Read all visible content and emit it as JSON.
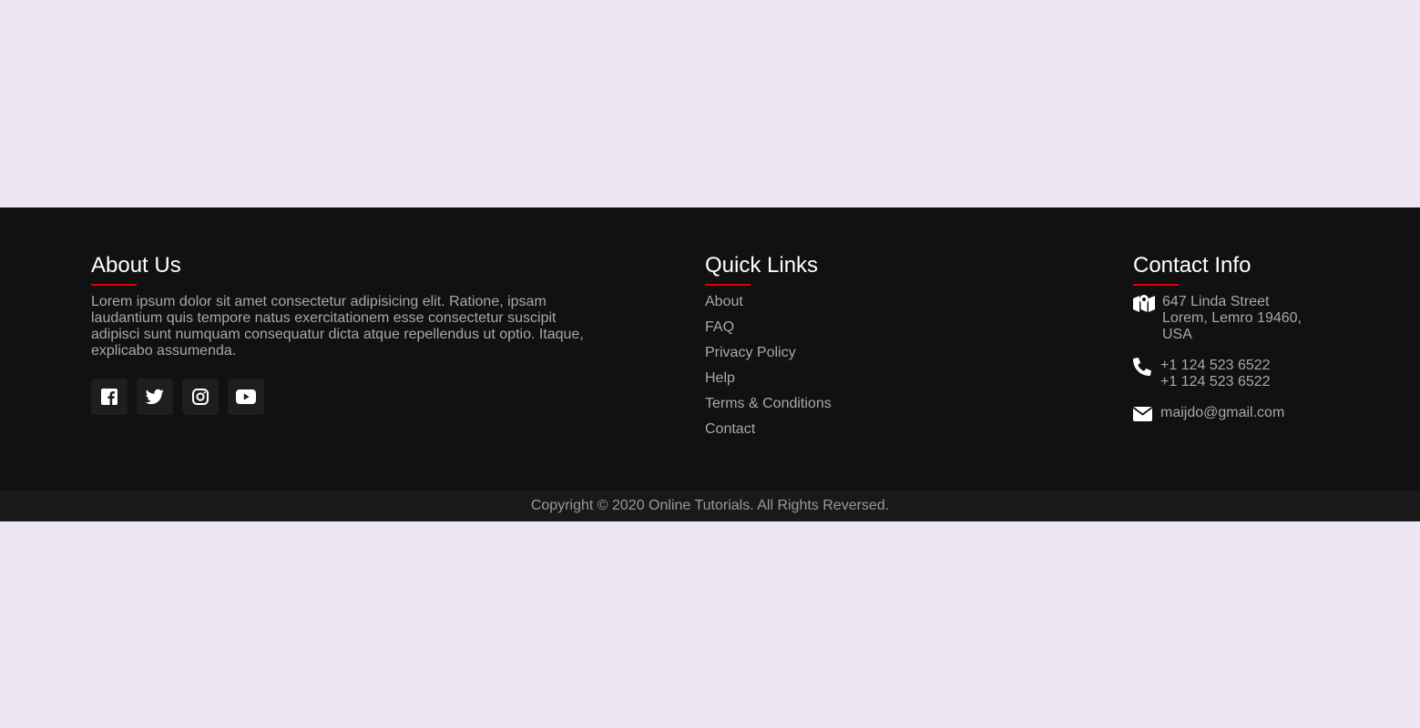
{
  "about": {
    "title": "About Us",
    "text": "Lorem ipsum dolor sit amet consectetur adipisicing elit. Ratione, ipsam laudantium quis tempore natus exercitationem esse consectetur suscipit adipisci sunt numquam consequatur dicta atque repellendus ut optio. Itaque, explicabo assumenda.",
    "social": [
      {
        "icon": "facebook-icon"
      },
      {
        "icon": "twitter-icon"
      },
      {
        "icon": "instagram-icon"
      },
      {
        "icon": "youtube-icon"
      }
    ]
  },
  "quick_links": {
    "title": "Quick Links",
    "items": [
      {
        "label": "About"
      },
      {
        "label": "FAQ"
      },
      {
        "label": "Privacy Policy"
      },
      {
        "label": "Help"
      },
      {
        "label": "Terms & Conditions"
      },
      {
        "label": "Contact"
      }
    ]
  },
  "contact": {
    "title": "Contact Info",
    "address": {
      "icon": "map-icon",
      "line1": "647 Linda Street",
      "line2": "Lorem, Lemro 19460,",
      "line3": "USA"
    },
    "phone": {
      "icon": "phone-icon",
      "line1": "+1 124 523 6522",
      "line2": "+1 124 523 6522"
    },
    "email": {
      "icon": "envelope-icon",
      "value": "maijdo@gmail.com"
    }
  },
  "copyright": "Copyright © 2020 Online Tutorials. All Rights Reversed.",
  "colors": {
    "page_background": "#ece6f5",
    "footer_background": "#111111",
    "accent": "#e10000",
    "text_muted": "#a8a8a8"
  }
}
